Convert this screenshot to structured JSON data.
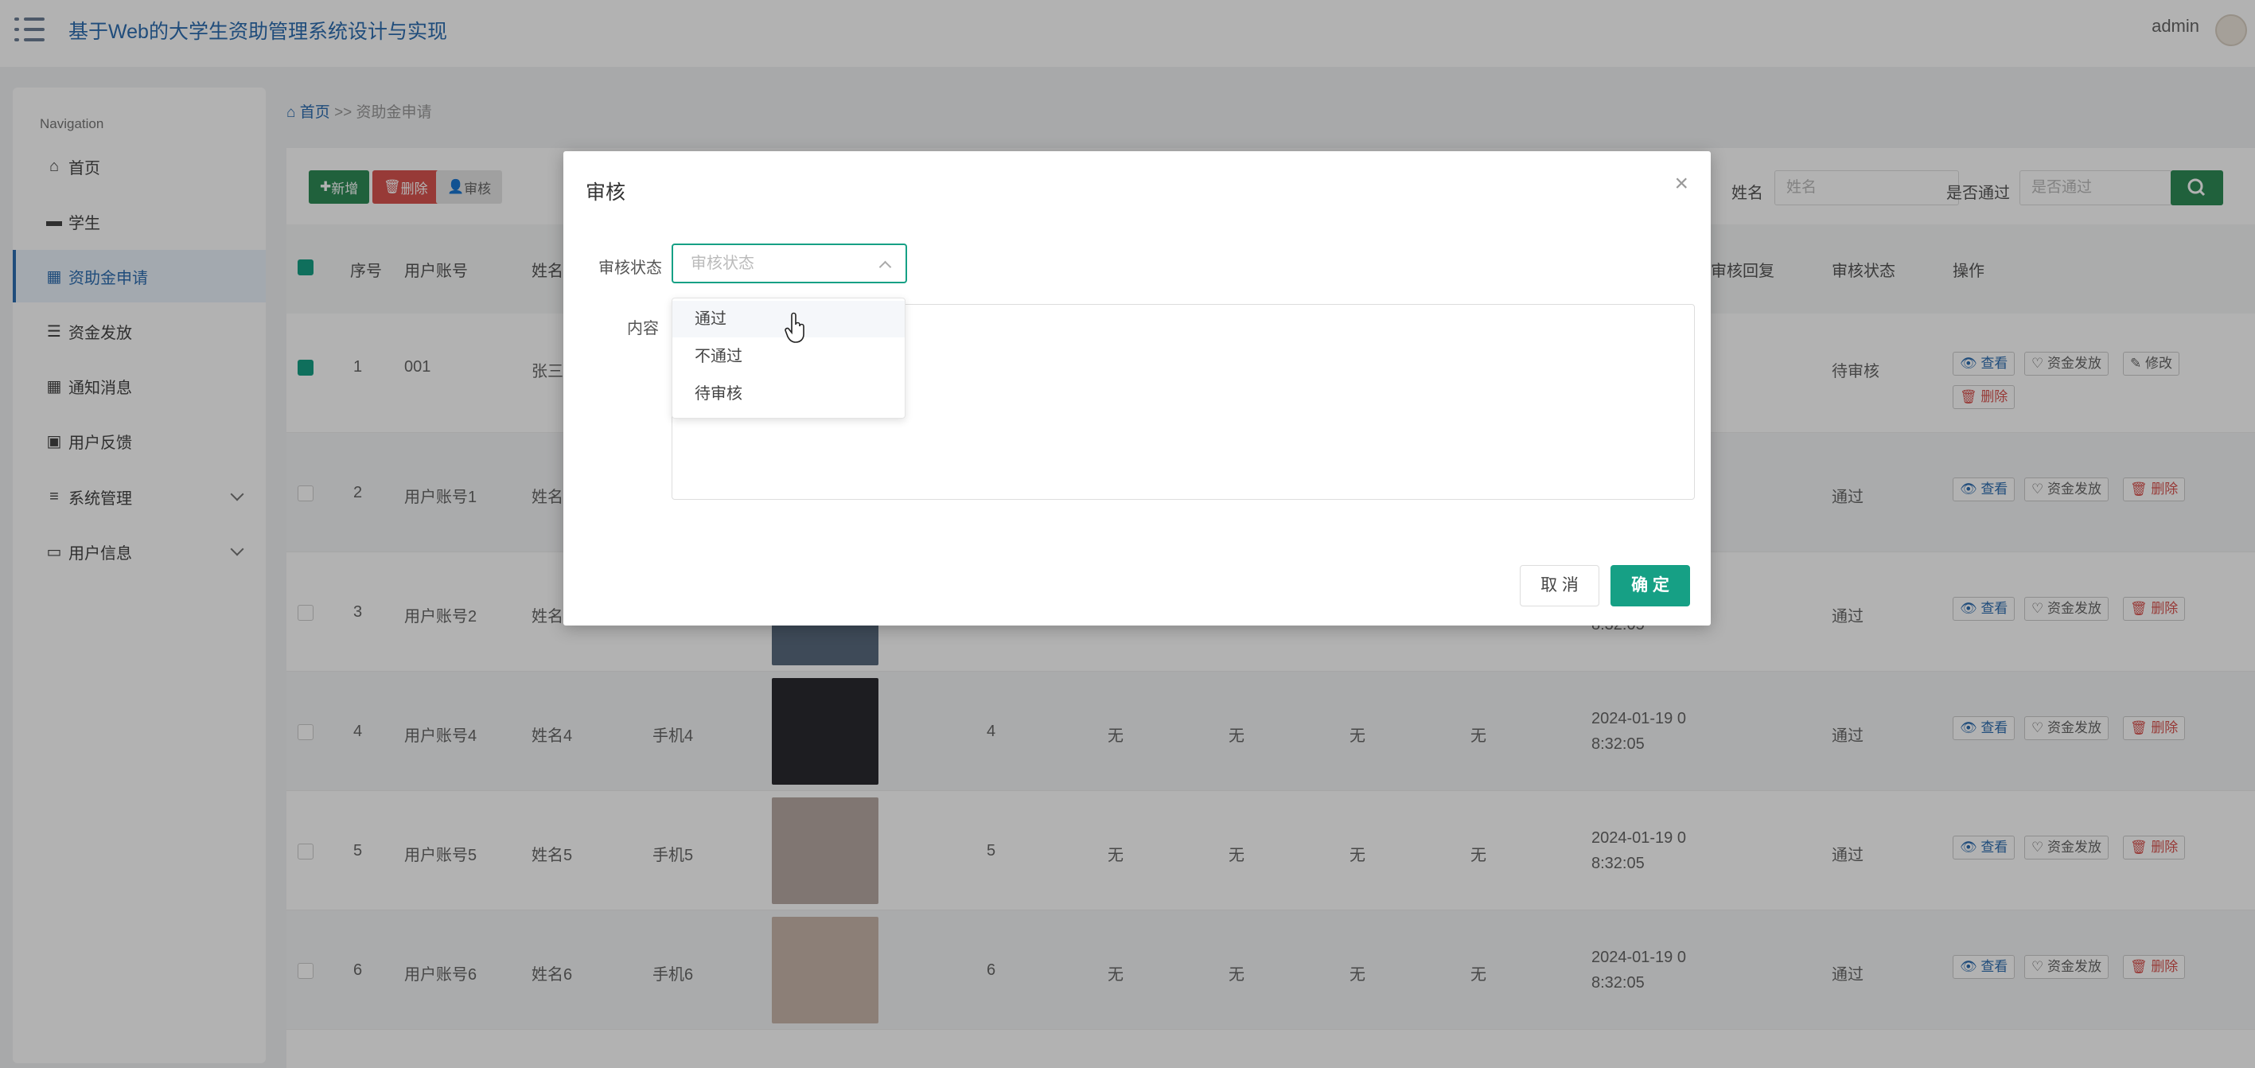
{
  "app": {
    "title": "基于Web的大学生资助管理系统设计与实现",
    "user": "admin"
  },
  "sidebar": {
    "nav_title": "Navigation",
    "items": [
      {
        "label": "首页",
        "icon": "home-icon"
      },
      {
        "label": "学生",
        "icon": "briefcase-icon"
      },
      {
        "label": "资助金申请",
        "icon": "grid-icon",
        "active": true
      },
      {
        "label": "资金发放",
        "icon": "sliders-icon"
      },
      {
        "label": "通知消息",
        "icon": "grid-icon"
      },
      {
        "label": "用户反馈",
        "icon": "printer-icon"
      },
      {
        "label": "系统管理",
        "icon": "list-icon",
        "expandable": true
      },
      {
        "label": "用户信息",
        "icon": "card-icon",
        "expandable": true
      }
    ]
  },
  "breadcrumb": {
    "home": "首页",
    "sep": ">>",
    "current": "资助金申请"
  },
  "toolbar": {
    "add": "新增",
    "delete": "删除",
    "audit": "审核"
  },
  "search": {
    "name_label": "姓名",
    "name_placeholder": "姓名",
    "pass_label": "是否通过",
    "pass_placeholder": "是否通过"
  },
  "table": {
    "headers": {
      "index": "序号",
      "account": "用户账号",
      "name": "姓名",
      "reply": "审核回复",
      "status": "审核状态",
      "ops": "操作"
    },
    "rows": [
      {
        "index": "1",
        "account": "001",
        "name": "张三",
        "phone": "",
        "count": "",
        "c1": "",
        "c2": "",
        "c3": "",
        "c4": "",
        "time1": "",
        "time2": "",
        "status": "待审核",
        "checked": true
      },
      {
        "index": "2",
        "account": "用户账号1",
        "name": "姓名",
        "phone": "",
        "count": "",
        "c1": "",
        "c2": "",
        "c3": "",
        "c4": "",
        "time1": "",
        "time2": "",
        "status": "通过"
      },
      {
        "index": "3",
        "account": "用户账号2",
        "name": "姓名",
        "phone": "",
        "count": "",
        "c1": "",
        "c2": "",
        "c3": "",
        "c4": "",
        "time1": "",
        "time2": "8:32:05",
        "status": "通过"
      },
      {
        "index": "4",
        "account": "用户账号4",
        "name": "姓名4",
        "phone": "手机4",
        "count": "4",
        "c1": "无",
        "c2": "无",
        "c3": "无",
        "c4": "无",
        "time1": "2024-01-19 0",
        "time2": "8:32:05",
        "status": "通过"
      },
      {
        "index": "5",
        "account": "用户账号5",
        "name": "姓名5",
        "phone": "手机5",
        "count": "5",
        "c1": "无",
        "c2": "无",
        "c3": "无",
        "c4": "无",
        "time1": "2024-01-19 0",
        "time2": "8:32:05",
        "status": "通过"
      },
      {
        "index": "6",
        "account": "用户账号6",
        "name": "姓名6",
        "phone": "手机6",
        "count": "6",
        "c1": "无",
        "c2": "无",
        "c3": "无",
        "c4": "无",
        "time1": "2024-01-19 0",
        "time2": "8:32:05",
        "status": "通过"
      }
    ],
    "ops": {
      "view": "查看",
      "fund": "资金发放",
      "edit": "修改",
      "delete": "删除"
    }
  },
  "modal": {
    "title": "审核",
    "status_label": "审核状态",
    "status_placeholder": "审核状态",
    "content_label": "内容",
    "cancel": "取 消",
    "confirm": "确 定",
    "options": [
      "通过",
      "不通过",
      "待审核"
    ]
  },
  "colors": {
    "primary": "#2d6db1",
    "accent": "#16a085",
    "success": "#2e8b57",
    "danger": "#d9534f",
    "muted": "#999"
  }
}
